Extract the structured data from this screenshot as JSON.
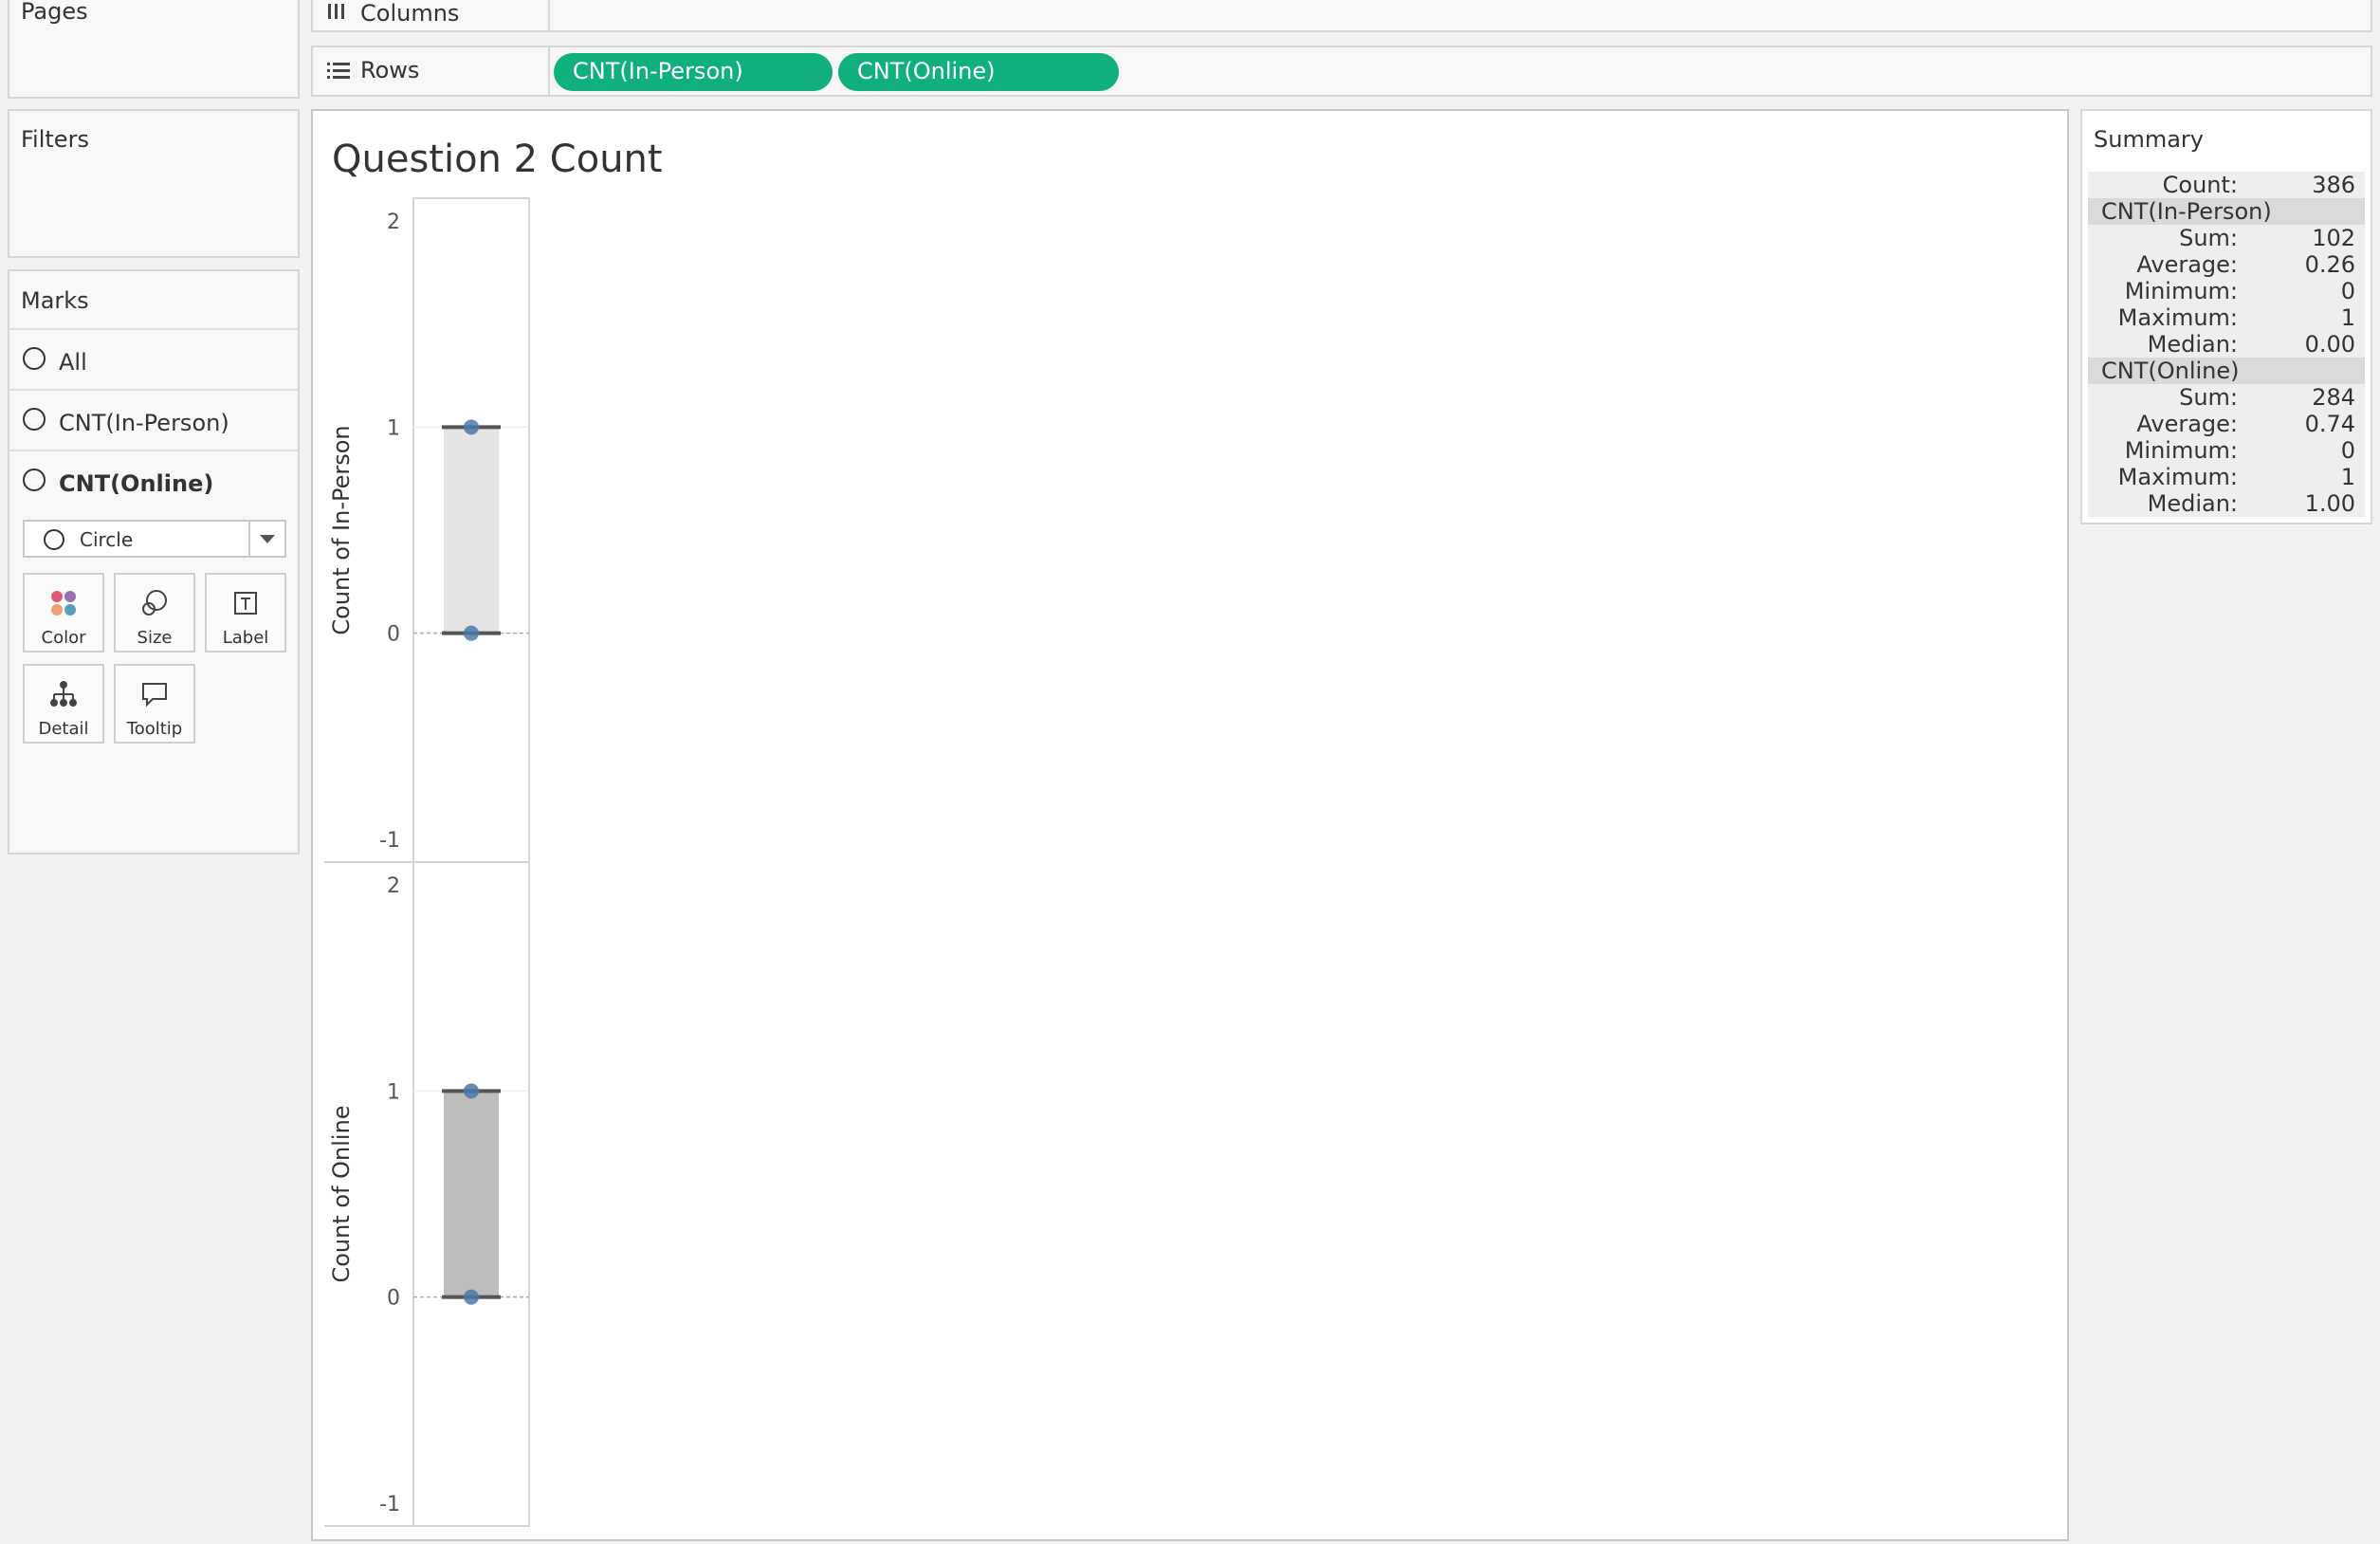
{
  "pages": {
    "title": "Pages"
  },
  "filters": {
    "title": "Filters"
  },
  "marks": {
    "title": "Marks",
    "cards": [
      {
        "label": "All",
        "selected": false
      },
      {
        "label": "CNT(In-Person)",
        "selected": false
      },
      {
        "label": "CNT(Online)",
        "selected": true
      }
    ],
    "mark_type": "Circle",
    "buttons": {
      "color": "Color",
      "size": "Size",
      "label": "Label",
      "detail": "Detail",
      "tooltip": "Tooltip"
    }
  },
  "shelves": {
    "columns": {
      "label": "Columns"
    },
    "rows": {
      "label": "Rows",
      "pills": [
        "CNT(In-Person)",
        "CNT(Online)"
      ]
    },
    "pill_color": "#0fb07e"
  },
  "viz": {
    "title": "Question 2 Count"
  },
  "chart_data": {
    "type": "box-plot",
    "panes": [
      {
        "ylabel": "Count of In-Person",
        "ylim": [
          -1,
          2
        ],
        "ticks": [
          "2",
          "1",
          "0",
          "-1"
        ],
        "box": {
          "lower": 0,
          "upper": 1,
          "fill": "#e4e4e4"
        },
        "points": [
          1,
          0
        ]
      },
      {
        "ylabel": "Count of Online",
        "ylim": [
          -1,
          2
        ],
        "ticks": [
          "2",
          "1",
          "0",
          "-1"
        ],
        "box": {
          "lower": 0,
          "upper": 1,
          "fill": "#bdbdbd"
        },
        "points": [
          1,
          0
        ]
      }
    ],
    "point_color": "#4e79a7"
  },
  "summary": {
    "title": "Summary",
    "count_label": "Count:",
    "count_value": "386",
    "sections": [
      {
        "name": "CNT(In-Person)",
        "rows": [
          {
            "k": "Sum:",
            "v": "102"
          },
          {
            "k": "Average:",
            "v": "0.26"
          },
          {
            "k": "Minimum:",
            "v": "0"
          },
          {
            "k": "Maximum:",
            "v": "1"
          },
          {
            "k": "Median:",
            "v": "0.00"
          }
        ]
      },
      {
        "name": "CNT(Online)",
        "rows": [
          {
            "k": "Sum:",
            "v": "284"
          },
          {
            "k": "Average:",
            "v": "0.74"
          },
          {
            "k": "Minimum:",
            "v": "0"
          },
          {
            "k": "Maximum:",
            "v": "1"
          },
          {
            "k": "Median:",
            "v": "1.00"
          }
        ]
      }
    ]
  }
}
